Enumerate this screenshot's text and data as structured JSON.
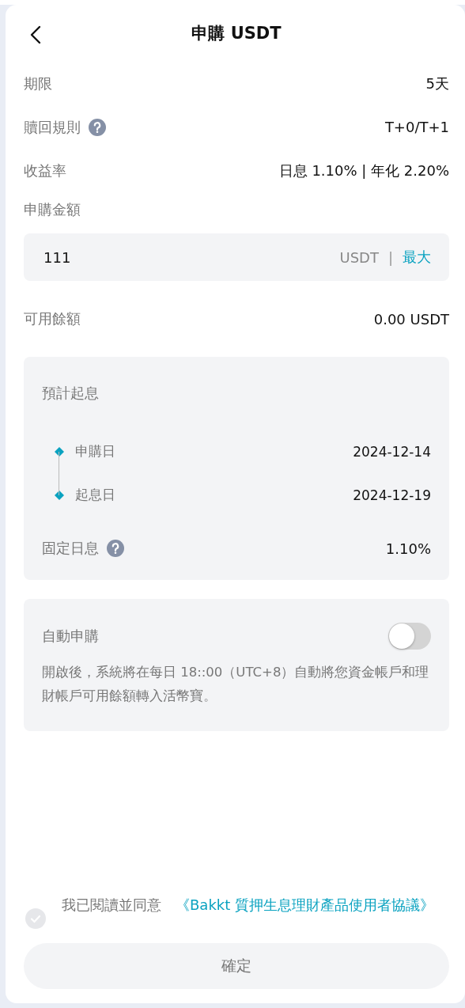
{
  "header": {
    "title": "申購 USDT"
  },
  "info_rows": [
    {
      "label": "期限",
      "value": "5天",
      "help": false
    },
    {
      "label": "贖回規則",
      "value": "T+0/T+1",
      "help": true
    },
    {
      "label": "收益率",
      "value": "日息 1.10% | 年化 2.20%",
      "help": false
    }
  ],
  "amount": {
    "label": "申購金額",
    "value": "111",
    "unit": "USDT",
    "separator": "|",
    "max": "最大"
  },
  "balance": {
    "label": "可用餘額",
    "value": "0.00 USDT"
  },
  "schedule": {
    "title": "預計起息",
    "steps": [
      {
        "label": "申購日",
        "date": "2024-12-14"
      },
      {
        "label": "起息日",
        "date": "2024-12-19"
      }
    ],
    "fixed_label": "固定日息",
    "fixed_value": "1.10%"
  },
  "auto": {
    "label": "自動申購",
    "on": false,
    "description": "開啟後，系統將在每日 18::00（UTC+8）自動將您資金帳戶和理財帳戶可用餘額轉入活幣寶。"
  },
  "agreement": {
    "checked": false,
    "text": "我已閱讀並同意",
    "link": "《Bakkt 質押生息理財產品使用者協議》"
  },
  "confirm": {
    "label": "確定",
    "disabled": true
  }
}
